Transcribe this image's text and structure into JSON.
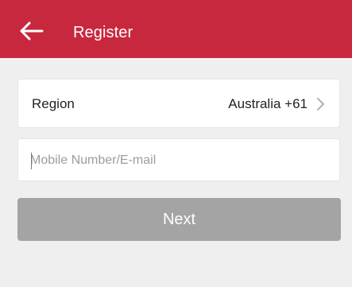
{
  "header": {
    "title": "Register",
    "back_icon": "arrow-left-icon",
    "background": "#c8283e"
  },
  "region": {
    "label": "Region",
    "value": "Australia +61",
    "chevron_icon": "chevron-right-icon"
  },
  "input": {
    "placeholder": "Mobile Number/E-mail",
    "value": ""
  },
  "next_button": {
    "label": "Next",
    "background": "#a4a4a4"
  }
}
